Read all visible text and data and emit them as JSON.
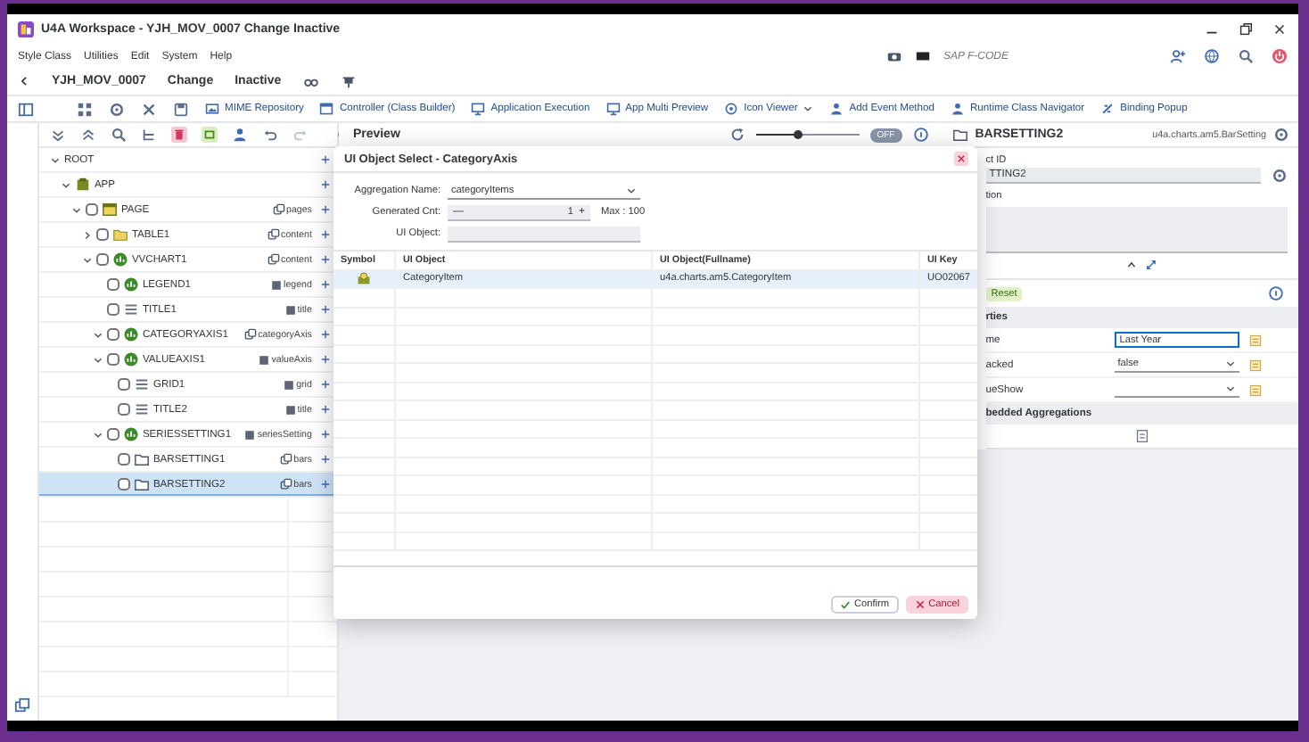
{
  "window": {
    "title": "U4A Workspace - YJH_MOV_0007 Change Inactive"
  },
  "menu": [
    "Style Class",
    "Utilities",
    "Edit",
    "System",
    "Help"
  ],
  "fcode": {
    "placeholder": "SAP F-CODE"
  },
  "header": {
    "app_id": "YJH_MOV_0007",
    "mode": "Change",
    "status": "Inactive"
  },
  "toolbar": [
    {
      "label": "MIME Repository",
      "kind": "button"
    },
    {
      "label": "Controller (Class Builder)",
      "kind": "button"
    },
    {
      "label": "Application Execution",
      "kind": "button"
    },
    {
      "label": "App Multi Preview",
      "kind": "button"
    },
    {
      "label": "Icon Viewer",
      "kind": "menu"
    },
    {
      "label": "Add Event Method",
      "kind": "button"
    },
    {
      "label": "Runtime Class Navigator",
      "kind": "button"
    },
    {
      "label": "Binding Popup",
      "kind": "button"
    }
  ],
  "tree": [
    {
      "label": "ROOT",
      "expanded": true,
      "selected": false,
      "children": [
        {
          "label": "APP",
          "kind": "app",
          "expanded": true,
          "selected": false,
          "children": [
            {
              "label": "PAGE",
              "kind": "page",
              "checked": false,
              "expanded": true,
              "selected": false,
              "aggregation": {
                "name": "pages",
                "kind": "multiple"
              },
              "children": [
                {
                  "label": "TABLE1",
                  "kind": "table",
                  "checked": false,
                  "expanded": false,
                  "selected": false,
                  "aggregation": {
                    "name": "content",
                    "kind": "multiple"
                  }
                },
                {
                  "label": "VVCHART1",
                  "kind": "chart",
                  "checked": false,
                  "expanded": true,
                  "selected": false,
                  "aggregation": {
                    "name": "content",
                    "kind": "multiple"
                  },
                  "children": [
                    {
                      "label": "LEGEND1",
                      "kind": "chart",
                      "checked": false,
                      "selected": false,
                      "aggregation": {
                        "name": "legend",
                        "kind": "single"
                      }
                    },
                    {
                      "label": "TITLE1",
                      "kind": "title",
                      "checked": false,
                      "selected": false,
                      "aggregation": {
                        "name": "title",
                        "kind": "single"
                      }
                    },
                    {
                      "label": "CATEGORYAXIS1",
                      "kind": "chart",
                      "checked": false,
                      "expanded": true,
                      "selected": false,
                      "aggregation": {
                        "name": "categoryAxis",
                        "kind": "multiple"
                      }
                    },
                    {
                      "label": "VALUEAXIS1",
                      "kind": "chart",
                      "checked": false,
                      "expanded": true,
                      "selected": false,
                      "aggregation": {
                        "name": "valueAxis",
                        "kind": "single"
                      },
                      "children": [
                        {
                          "label": "GRID1",
                          "kind": "grid",
                          "checked": false,
                          "selected": false,
                          "aggregation": {
                            "name": "grid",
                            "kind": "single"
                          }
                        },
                        {
                          "label": "TITLE2",
                          "kind": "title",
                          "checked": false,
                          "selected": false,
                          "aggregation": {
                            "name": "title",
                            "kind": "single"
                          }
                        }
                      ]
                    },
                    {
                      "label": "SERIESSETTING1",
                      "kind": "chart",
                      "checked": false,
                      "expanded": true,
                      "selected": false,
                      "aggregation": {
                        "name": "seriesSetting",
                        "kind": "single"
                      },
                      "children": [
                        {
                          "label": "BARSETTING1",
                          "kind": "bar",
                          "checked": false,
                          "selected": false,
                          "aggregation": {
                            "name": "bars",
                            "kind": "multiple"
                          }
                        },
                        {
                          "label": "BARSETTING2",
                          "kind": "bar",
                          "checked": false,
                          "selected": true,
                          "aggregation": {
                            "name": "bars",
                            "kind": "multiple"
                          }
                        }
                      ]
                    }
                  ]
                }
              ]
            }
          ]
        }
      ]
    }
  ],
  "preview": {
    "title": "Preview",
    "zoom": {
      "level": 0.4
    },
    "toggle": {
      "label": "OFF",
      "on": false
    }
  },
  "dialog": {
    "title": "UI Object Select - CategoryAxis",
    "fields": [
      {
        "label": "Aggregation Name:",
        "kind": "select",
        "value": "categoryItems"
      },
      {
        "label": "Generated Cnt:",
        "kind": "stepper",
        "minus": "—",
        "value": "1",
        "plus": "+",
        "max": "Max : 100"
      },
      {
        "label": "UI Object:",
        "kind": "text"
      }
    ],
    "table": {
      "columns": [
        "Symbol",
        "UI Object",
        "UI Object(Fullname)",
        "UI Key"
      ],
      "rows": [
        {
          "ui_object": "CategoryItem",
          "fullname": "u4a.charts.am5.CategoryItem",
          "ui_key": "UO02067",
          "selected": true
        }
      ]
    },
    "buttons": [
      {
        "label": "Confirm",
        "kind": "confirm"
      },
      {
        "label": "Cancel",
        "kind": "cancel"
      }
    ]
  },
  "properties_panel": {
    "title": "BARSETTING2",
    "class_name": "u4a.charts.am5.BarSetting",
    "id_label": "ct ID",
    "id_value": "TTING2",
    "description_label": "tion",
    "reset": "Reset",
    "properties_title": "rties",
    "properties": [
      {
        "name": "me",
        "kind": "input",
        "value": "Last Year"
      },
      {
        "name": "acked",
        "kind": "select",
        "value": "false"
      },
      {
        "name": "ueShow",
        "kind": "select"
      }
    ],
    "embedded_title": "bedded Aggregations"
  }
}
